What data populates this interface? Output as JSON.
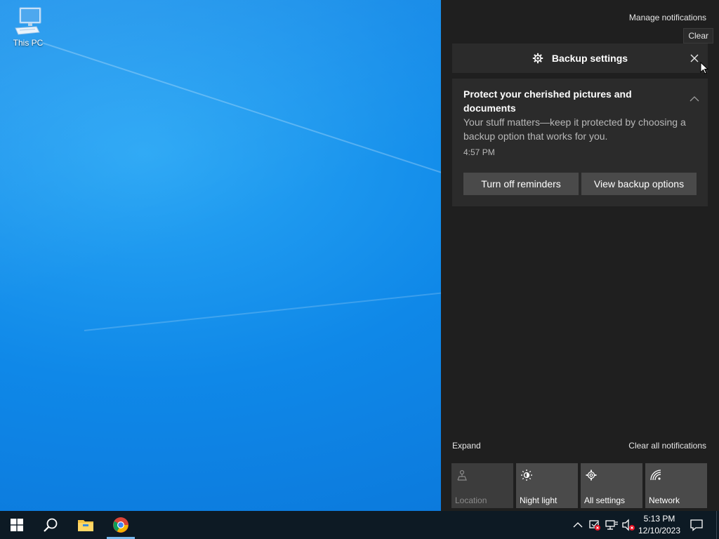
{
  "desktop": {
    "icons": [
      {
        "label": "This PC",
        "icon": "computer-icon"
      }
    ]
  },
  "action_center": {
    "manage_label": "Manage notifications",
    "clear_tooltip": "Clear",
    "group": {
      "title": "Backup settings",
      "icon": "gear-icon"
    },
    "notification": {
      "title": "Protect your cherished pictures and documents",
      "body": "Your stuff matters—keep it protected by choosing a backup option that works for you.",
      "time": "4:57 PM",
      "buttons": [
        "Turn off reminders",
        "View backup options"
      ]
    },
    "expand_label": "Expand",
    "clear_all_label": "Clear all notifications",
    "quick_actions": [
      {
        "label": "Location",
        "icon": "location-icon",
        "enabled": false
      },
      {
        "label": "Night light",
        "icon": "night-light-icon",
        "enabled": true
      },
      {
        "label": "All settings",
        "icon": "gear-icon",
        "enabled": true
      },
      {
        "label": "Network",
        "icon": "network-icon",
        "enabled": true
      }
    ]
  },
  "taskbar": {
    "apps": [
      {
        "name": "start",
        "icon": "windows-logo-icon"
      },
      {
        "name": "search",
        "icon": "search-icon"
      },
      {
        "name": "file-explorer",
        "icon": "folder-icon"
      },
      {
        "name": "chrome",
        "icon": "chrome-icon",
        "active": true
      }
    ],
    "tray": [
      "chevron-up-icon",
      "security-alert-icon",
      "network-disconnected-icon",
      "volume-muted-icon"
    ],
    "clock": {
      "time": "5:13 PM",
      "date": "12/10/2023"
    }
  },
  "colors": {
    "panel_bg": "#1f1f1f",
    "card_bg": "#2b2b2b",
    "button_bg": "#4a4a4a",
    "taskbar_bg": "#0d1a24",
    "accent": "#76b9ed"
  }
}
